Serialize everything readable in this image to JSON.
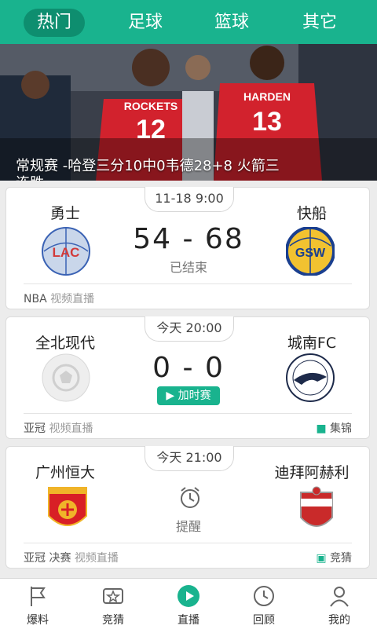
{
  "tabs": [
    {
      "label": "热门",
      "active": true
    },
    {
      "label": "足球",
      "active": false
    },
    {
      "label": "篮球",
      "active": false
    },
    {
      "label": "其它",
      "active": false
    }
  ],
  "hero": {
    "caption_line1": "常规赛 -哈登三分10中0韦德28+8 火箭三",
    "caption_line2": "连胜"
  },
  "matches": [
    {
      "time": "11-18 9:00",
      "home_name": "勇士",
      "home_logo": "LAC",
      "away_name": "快船",
      "away_logo": "GSW",
      "score": "54 - 68",
      "status": "已结束",
      "league": "NBA",
      "broadcast": "视频直播",
      "right_label": ""
    },
    {
      "time": "今天 20:00",
      "home_name": "全北现代",
      "home_logo": "placeholder-ball",
      "away_name": "城南FC",
      "away_logo": "seongnam",
      "score": "0 - 0",
      "status": "加时赛",
      "league": "亚冠",
      "broadcast": "视频直播",
      "right_label": "集锦"
    },
    {
      "time": "今天 21:00",
      "home_name": "广州恒大",
      "home_logo": "guangzhou",
      "away_name": "迪拜阿赫利",
      "away_logo": "al-ahli",
      "score": "",
      "status": "提醒",
      "league": "亚冠 决赛",
      "broadcast": "视频直播",
      "right_label": "竞猜"
    }
  ],
  "bottom_nav": [
    {
      "label": "爆料",
      "icon": "flag-icon"
    },
    {
      "label": "竞猜",
      "icon": "star-ticket-icon"
    },
    {
      "label": "直播",
      "icon": "play-icon",
      "active": true
    },
    {
      "label": "回顾",
      "icon": "clock-icon"
    },
    {
      "label": "我的",
      "icon": "person-icon"
    }
  ],
  "colors": {
    "accent": "#19b38e",
    "accent_dark": "#0e8e6f"
  }
}
